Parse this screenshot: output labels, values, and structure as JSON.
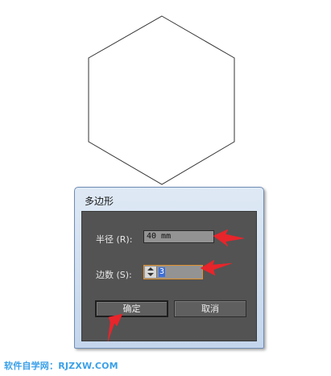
{
  "dialog": {
    "title": "多边形",
    "radius_label": "半径 (R):",
    "radius_value": "40 mm",
    "sides_label": "边数 (S):",
    "sides_value": "3",
    "ok_label": "确定",
    "cancel_label": "取消"
  },
  "canvas": {
    "shape": "hexagon",
    "stroke_color": "#333333"
  },
  "annotations": {
    "arrow_color": "#e8252b"
  },
  "watermark": {
    "text": "软件自学网：RJZXW.COM",
    "color": "#3aa0e8"
  }
}
